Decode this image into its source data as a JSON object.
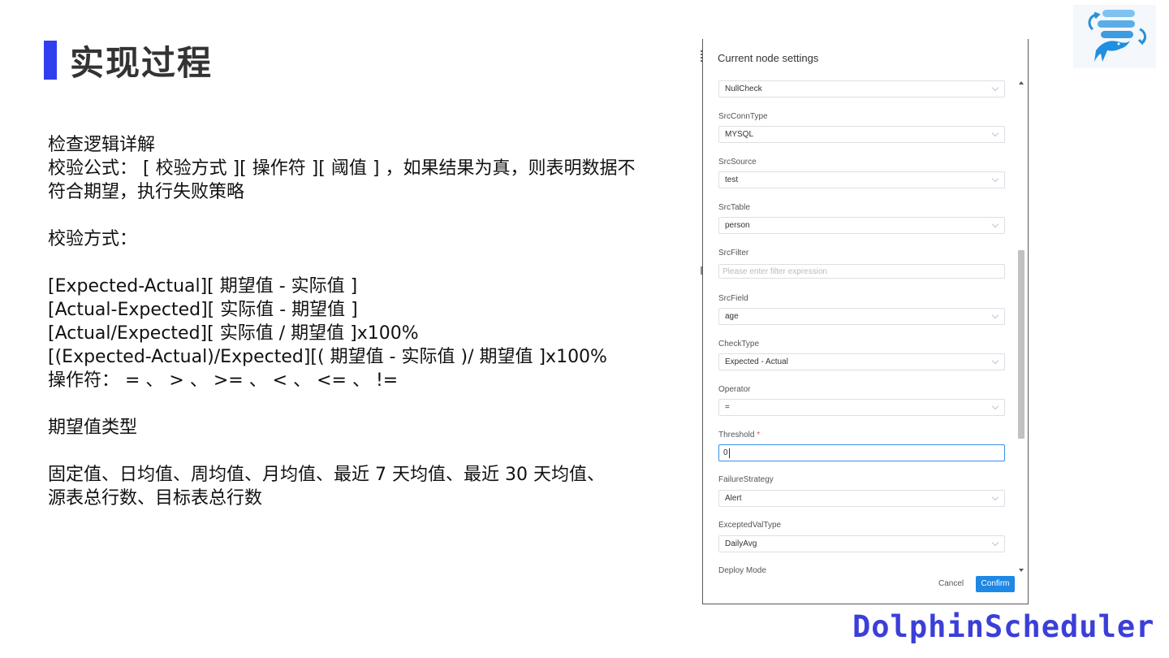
{
  "slide": {
    "title": "实现过程",
    "accent_color": "#2f3ff0",
    "brand": "DolphinScheduler",
    "brand_color": "#3b3fd8"
  },
  "body": {
    "l1": "检查逻辑详解",
    "l2": "校验公式： [ 校验方式 ][ 操作符 ][ 阈值 ] ，如果结果为真，则表明数据不",
    "l3": "符合期望，执行失败策略",
    "l4": "校验方式：",
    "l5": "[Expected-Actual][ 期望值 - 实际值 ]",
    "l6": "[Actual-Expected][ 实际值 - 期望值 ]",
    "l7": "[Actual/Expected][ 实际值 / 期望值 ]x100%",
    "l8": "[(Expected-Actual)/Expected][( 期望值 - 实际值 )/ 期望值 ]x100%",
    "l9": "操作符： = 、 > 、 >= 、 < 、 <= 、 !=",
    "l10": "期望值类型",
    "l11": "固定值、日均值、周均值、月均值、最近 7 天均值、最近 30 天均值、",
    "l12": "源表总行数、目标表总行数"
  },
  "dialog": {
    "title": "Current node settings",
    "rule_value": "NullCheck",
    "fields": {
      "src_conn_type": {
        "label": "SrcConnType",
        "value": "MYSQL"
      },
      "src_source": {
        "label": "SrcSource",
        "value": "test"
      },
      "src_table": {
        "label": "SrcTable",
        "value": "person"
      },
      "src_filter": {
        "label": "SrcFilter",
        "placeholder": "Please enter filter expression"
      },
      "src_field": {
        "label": "SrcField",
        "value": "age"
      },
      "check_type": {
        "label": "CheckType",
        "value": "Expected - Actual"
      },
      "operator": {
        "label": "Operator",
        "value": "="
      },
      "threshold": {
        "label": "Threshold",
        "required_mark": "*",
        "value": "0"
      },
      "failure_strategy": {
        "label": "FailureStrategy",
        "value": "Alert"
      },
      "expected_val_type": {
        "label": "ExceptedValType",
        "value": "DailyAvg"
      },
      "deploy_mode": {
        "label": "Deploy Mode"
      }
    },
    "cancel_label": "Cancel",
    "confirm_label": "Confirm",
    "confirm_color": "#1e88e5"
  },
  "icons": {
    "logo": "dolphinscheduler-logo-icon",
    "dropdown": "chevron-down-icon"
  }
}
